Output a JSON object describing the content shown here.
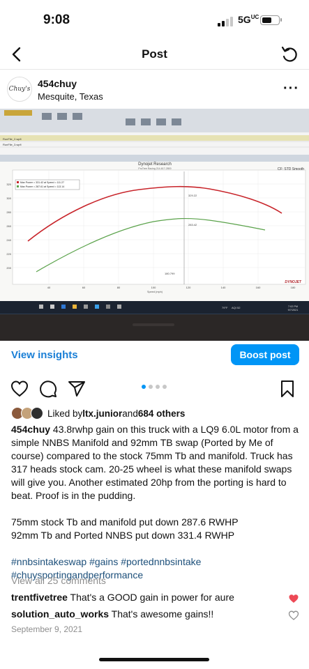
{
  "status": {
    "time": "9:08",
    "network": "5G",
    "network_suffix": "UC"
  },
  "nav": {
    "title": "Post"
  },
  "post": {
    "username": "454chuy",
    "location": "Mesquite, Texas",
    "avatar_text": "Chuy's"
  },
  "photo": {
    "dyno_title": "Dynojet Research",
    "dyno_subtitle": "ProTree Racing 214-617-2800",
    "corner_label": "CF: STD Smooth",
    "legend": [
      "Max Power = 331.42 at Speed = 111.27",
      "Max Power = 287.61 at Speed = 113.14"
    ],
    "peak_red": "329.22",
    "peak_green": "283.42",
    "speed_readout": "180.799",
    "x_label": "Speed (mph)",
    "x_ticks": [
      "40",
      "60",
      "80",
      "100",
      "120",
      "140",
      "160",
      "180"
    ],
    "y_ticks": [
      "320",
      "300",
      "280",
      "260",
      "240",
      "220",
      "200"
    ],
    "table_rows": [
      "RunFile_2.wpfi",
      "RunFile_3.wpfi"
    ],
    "tray": {
      "weather": "79°F",
      "aqi": "AQI 52",
      "time": "7:02 PM",
      "date": "9/7/2021"
    },
    "brand": "DYNOJET"
  },
  "insights": {
    "link": "View insights",
    "boost": "Boost post"
  },
  "likes": {
    "prefix": "Liked by ",
    "user": "ltx.junior",
    "and": " and ",
    "others": "684 others"
  },
  "caption": {
    "username": "454chuy",
    "text": " 43.8rwhp gain on this truck with a LQ9 6.0L motor from a simple NNBS Manifold and 92mm TB swap (Ported by Me of course) compared to the stock 75mm Tb and manifold. Truck has 317 heads stock cam. 20-25 wheel is what these manifold swaps will give you. Another estimated 20hp from the porting is hard to beat. Proof is in the pudding.",
    "line1": "75mm stock Tb and manifold put down 287.6 RWHP",
    "line2": "92mm Tb and Ported NNBS put down 331.4 RWHP",
    "hashtags": "#nnbsintakeswap #gains #portednnbsintake #chuysportingandperformance"
  },
  "comments": {
    "view_all": "View all 25 comments",
    "items": [
      {
        "user": "trentfivetree",
        "text": " That's a GOOD gain in power for aure",
        "liked": true
      },
      {
        "user": "solution_auto_works",
        "text": " That's awesome gains!!",
        "liked": false
      }
    ]
  },
  "date": "September 9, 2021",
  "colors": {
    "accent": "#0095f6",
    "like": "#ed4956",
    "red_curve": "#c8242a",
    "green_curve": "#5aa24a"
  }
}
